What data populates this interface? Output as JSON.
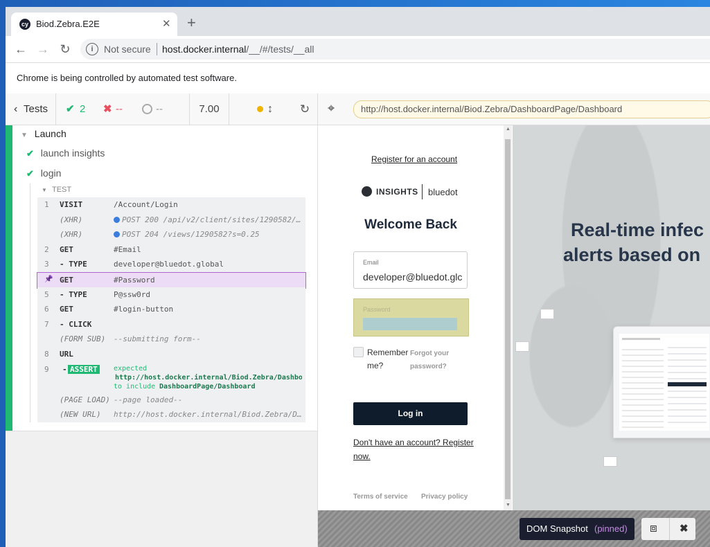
{
  "browser": {
    "tab_title": "Biod.Zebra.E2E",
    "tab_favicon": "cy",
    "url_security": "Not secure",
    "url_host": "host.docker.internal",
    "url_path": "/__/#/tests/__all",
    "infobar": "Chrome is being controlled by automated test software."
  },
  "runner": {
    "tests_label": "Tests",
    "passed": "2",
    "failed": "--",
    "pending": "--",
    "duration": "7.00",
    "aut_url": "http://host.docker.internal/Biod.Zebra/DashboardPage/Dashboard",
    "suite": "Launch",
    "tests": [
      "launch insights",
      "login"
    ],
    "test_section": "TEST",
    "commands": [
      {
        "num": "1",
        "name": "VISIT",
        "msg": "/Account/Login"
      },
      {
        "num": "",
        "name": "(XHR)",
        "msg": "POST 200 /api/v2/client/sites/1290582/…",
        "dot": true
      },
      {
        "num": "",
        "name": "(XHR)",
        "msg": "POST 204 /views/1290582?s=0.25",
        "dot": true
      },
      {
        "num": "2",
        "name": "GET",
        "msg": "#Email"
      },
      {
        "num": "3",
        "name": "- TYPE",
        "msg": "developer@bluedot.global"
      },
      {
        "num": "",
        "name": "GET",
        "msg": "#Password",
        "pinned": true
      },
      {
        "num": "5",
        "name": "- TYPE",
        "msg": "P@ssw0rd"
      },
      {
        "num": "6",
        "name": "GET",
        "msg": "#login-button"
      },
      {
        "num": "7",
        "name": "- CLICK",
        "msg": ""
      },
      {
        "num": "",
        "name": "(FORM SUB)",
        "msg": "--submitting form--"
      },
      {
        "num": "8",
        "name": "URL",
        "msg": ""
      }
    ],
    "assert": {
      "num": "9",
      "label": "ASSERT",
      "expected": "expected",
      "url": "http://host.docker.internal/Biod.Zebra/Dashboar…",
      "to_include": "to include",
      "target": "DashboardPage/Dashboard"
    },
    "trailing": [
      {
        "name": "(PAGE LOAD)",
        "msg": "--page loaded--"
      },
      {
        "name": "(NEW URL)",
        "msg": "http://host.docker.internal/Biod.Zebra/D…"
      }
    ]
  },
  "app": {
    "register_link": "Register for an account",
    "logo_brand": "INSIGHTS",
    "logo_company": "bluedot",
    "heading": "Welcome Back",
    "email_label": "Email",
    "email_value": "developer@bluedot.glc",
    "password_label": "Password",
    "remember_label_1": "Remember",
    "remember_label_2": "me?",
    "forgot_1": "Forgot your",
    "forgot_2": "password?",
    "login_button": "Log in",
    "no_account_1": "Don't have an account? Register",
    "no_account_2": "now.",
    "terms": "Terms of service",
    "privacy": "Privacy policy",
    "hero_line_1": "Real-time infec",
    "hero_line_2": "alerts based on"
  },
  "snapshot": {
    "label": "DOM Snapshot",
    "pinned": "(pinned)"
  },
  "colors": {
    "pass_green": "#1fb974",
    "fail_red": "#e94f5f",
    "pinned_bg": "#ecdcf5",
    "pinned_border": "#b065d0",
    "login_button_bg": "#0f1c2b",
    "highlight_yellow": "#d9d9a0",
    "assert_green": "#1fb974"
  }
}
